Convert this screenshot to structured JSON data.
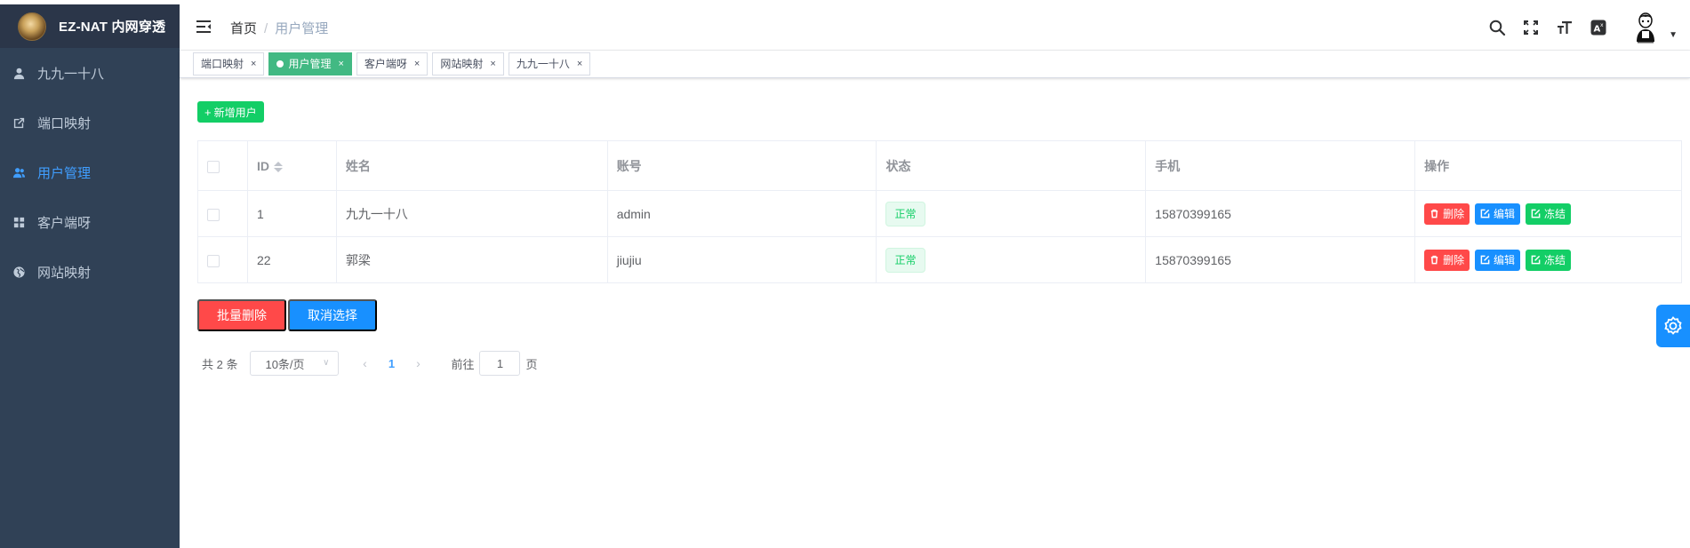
{
  "app": {
    "title": "EZ-NAT 内网穿透"
  },
  "sidebar": {
    "items": [
      {
        "label": "九九一十八",
        "icon": "user-icon"
      },
      {
        "label": "端口映射",
        "icon": "external-link-icon"
      },
      {
        "label": "用户管理",
        "icon": "peoples-icon",
        "active": true
      },
      {
        "label": "客户端呀",
        "icon": "dashboard-grid-icon"
      },
      {
        "label": "网站映射",
        "icon": "globe-icon"
      }
    ]
  },
  "header": {
    "breadcrumb": {
      "home": "首页",
      "separator": "/",
      "current": "用户管理"
    }
  },
  "tags": [
    {
      "label": "端口映射",
      "close": "×"
    },
    {
      "label": "用户管理",
      "close": "×",
      "active": true
    },
    {
      "label": "客户端呀",
      "close": "×"
    },
    {
      "label": "网站映射",
      "close": "×"
    },
    {
      "label": "九九一十八",
      "close": "×"
    }
  ],
  "toolbar": {
    "add_label": "新增用户",
    "add_icon": "+"
  },
  "table": {
    "headers": {
      "id": "ID",
      "name": "姓名",
      "account": "账号",
      "status": "状态",
      "phone": "手机",
      "actions": "操作"
    },
    "rows": [
      {
        "id": "1",
        "name": "九九一十八",
        "account": "admin",
        "status": "正常",
        "phone": "15870399165"
      },
      {
        "id": "22",
        "name": "郭梁",
        "account": "jiujiu",
        "status": "正常",
        "phone": "15870399165"
      }
    ],
    "actions": {
      "delete": "删除",
      "edit": "编辑",
      "freeze": "冻结"
    }
  },
  "batch": {
    "delete_label": "批量删除",
    "cancel_label": "取消选择"
  },
  "pagination": {
    "total": "共 2 条",
    "page_size": "10条/页",
    "current_page": "1",
    "goto_prefix": "前往",
    "goto_value": "1",
    "goto_suffix": "页",
    "prev": "‹",
    "next": "›"
  },
  "colors": {
    "sidebar_bg": "#304156",
    "active_menu": "#409eff",
    "tag_active": "#42b983",
    "success": "#13ce66",
    "danger": "#ff4949",
    "primary": "#1890ff"
  }
}
